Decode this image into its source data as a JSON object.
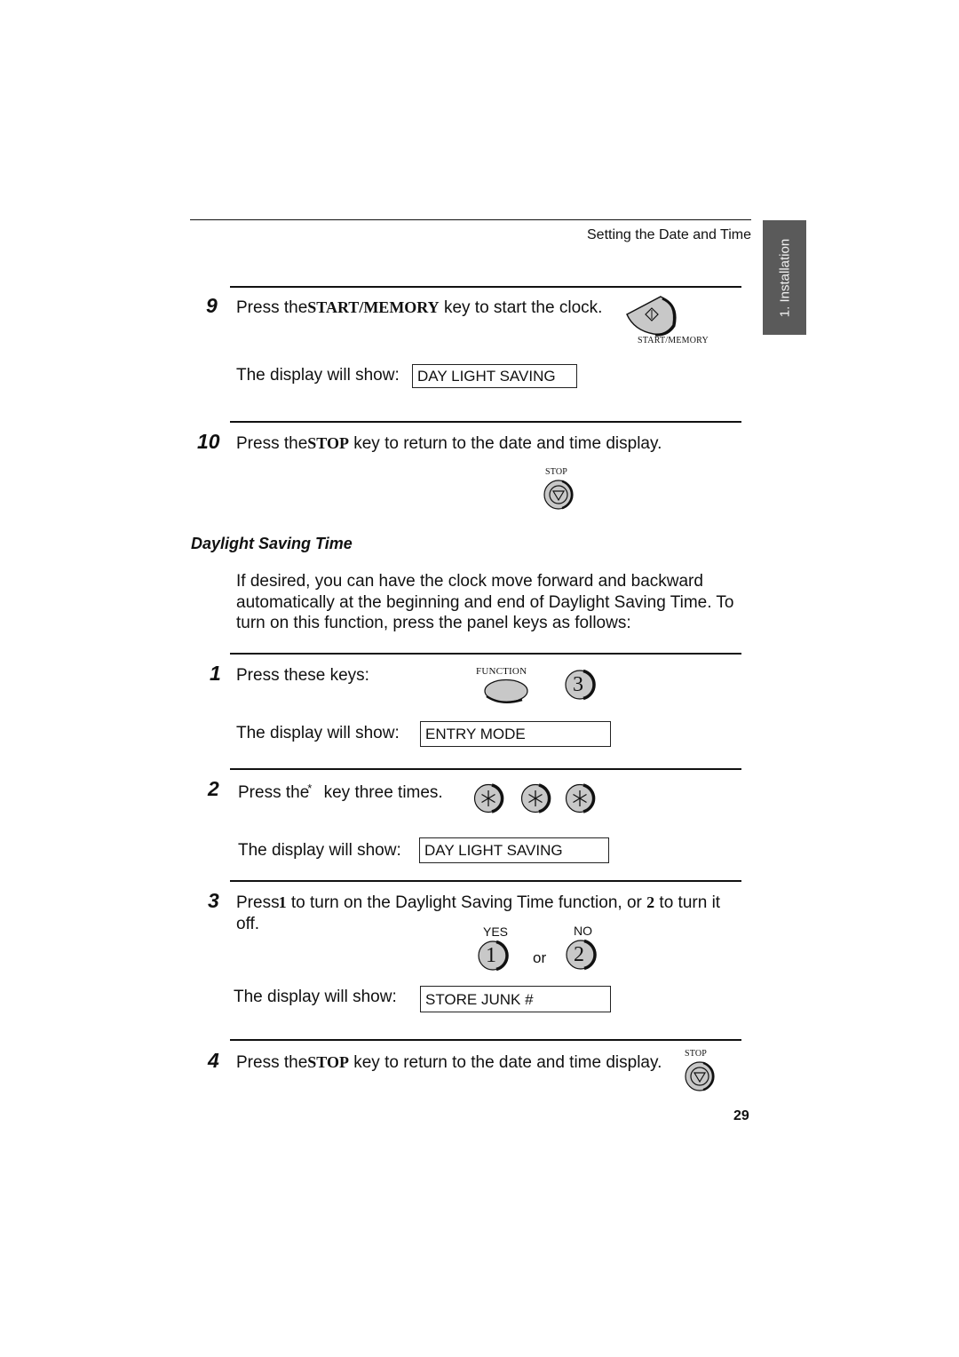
{
  "header": {
    "running_head": "Setting the Date and Time",
    "side_tab": "1. Installation"
  },
  "steps_top": [
    {
      "number": "9",
      "text_before": "Press the",
      "keyword": "START/MEMORY",
      "text_after": "key to start the clock.",
      "key_caption": "START/MEMORY",
      "display_label": "The display will show:",
      "display_value": "DAY LIGHT SAVING"
    },
    {
      "number": "10",
      "text_before": "Press the",
      "keyword": "STOP",
      "text_after": "key to return to the date and time display.",
      "key_caption": "STOP"
    }
  ],
  "section": {
    "title": "Daylight Saving Time",
    "intro_lines": [
      "If desired, you can have the clock move forward and backward",
      "automatically at the beginning and end of Daylight Saving Time. To",
      "turn on this function, press the panel keys as follows:"
    ]
  },
  "steps": [
    {
      "number": "1",
      "text": "Press these keys:",
      "key_caption": "FUNCTION",
      "key_digit": "3",
      "display_label": "The display will show:",
      "display_value": "ENTRY MODE"
    },
    {
      "number": "2",
      "text_before": "Press the",
      "keyword": "*",
      "text_after": "key three times.",
      "key_symbol": "*",
      "display_label": "The display will show:",
      "display_value": "DAY LIGHT SAVING"
    },
    {
      "number": "3",
      "text_before": "Press",
      "keyword_1": "1",
      "text_middle": "to turn on the Daylight Saving Time function, or",
      "keyword_2": "2",
      "text_after": "to turn it",
      "text_line2": "off.",
      "yes_label": "YES",
      "no_label": "NO",
      "yes_digit": "1",
      "no_digit": "2",
      "or_text": "or",
      "display_label": "The display will show:",
      "display_value": "STORE JUNK #"
    },
    {
      "number": "4",
      "text_before": "Press the",
      "keyword": "STOP",
      "text_after": "key to return to the date and time display.",
      "key_caption": "STOP"
    }
  ],
  "footer": {
    "page_number": "29"
  }
}
